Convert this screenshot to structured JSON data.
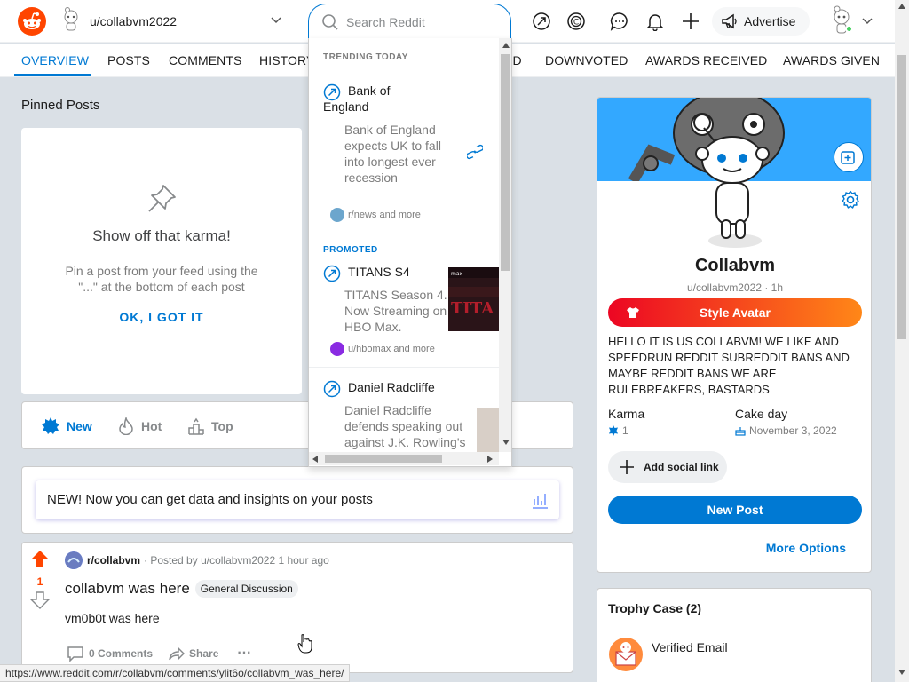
{
  "header": {
    "username": "u/collabvm2022",
    "search_placeholder": "Search Reddit",
    "advertise_label": "Advertise"
  },
  "tabs": [
    {
      "label": "OVERVIEW",
      "active": true
    },
    {
      "label": "POSTS"
    },
    {
      "label": "COMMENTS"
    },
    {
      "label": "HISTORY"
    },
    {
      "label": "ED"
    },
    {
      "label": "DOWNVOTED"
    },
    {
      "label": "AWARDS RECEIVED"
    },
    {
      "label": "AWARDS GIVEN"
    }
  ],
  "trending": {
    "heading": "TRENDING TODAY",
    "promo_heading": "PROMOTED",
    "items": [
      {
        "title": "Bank of England",
        "desc": "Bank of England expects UK to fall into longest ever recession",
        "source": "r/news and more"
      },
      {
        "title": "TITANS S4",
        "desc": "TITANS Season 4. Now Streaming on HBO Max.",
        "source": "u/hbomax and more",
        "thumb_text": "TITA"
      },
      {
        "title": "Daniel Radcliffe",
        "desc": "Daniel Radcliffe defends speaking out against J.K. Rowling's"
      }
    ]
  },
  "pinned": {
    "title": "Pinned Posts",
    "card_title": "Show off that karma!",
    "card_desc": "Pin a post from your feed using the \"...\" at the bottom of each post",
    "card_button": "OK, I GOT IT"
  },
  "sort": {
    "new": "New",
    "hot": "Hot",
    "top": "Top"
  },
  "insights_text": "NEW! Now you can get data and insights on your posts",
  "post": {
    "subreddit": "r/collabvm",
    "meta": "· Posted by u/collabvm2022 1 hour ago",
    "score": "1",
    "title": "collabvm was here",
    "flair": "General Discussion",
    "body": "vm0b0t was here",
    "comments": "0 Comments",
    "share": "Share",
    "more": "···"
  },
  "status_url": "https://www.reddit.com/r/collabvm/comments/ylit6o/collabvm_was_here/",
  "profile": {
    "name": "Collabvm",
    "sub": "u/collabvm2022 · 1h",
    "style_avatar": "Style Avatar",
    "about": "HELLO IT IS US COLLABVM! WE LIKE AND SPEEDRUN REDDIT SUBREDDIT BANS AND MAYBE REDDIT BANS WE ARE RULEBREAKERS, BASTARDS",
    "karma_label": "Karma",
    "karma_value": "1",
    "cakeday_label": "Cake day",
    "cakeday_value": "November 3, 2022",
    "social": "Add social link",
    "new_post": "New Post",
    "more_options": "More Options"
  },
  "trophy": {
    "title": "Trophy Case (2)",
    "item": "Verified Email"
  },
  "colors": {
    "brand": "#ff4500",
    "accent": "#0079d3"
  }
}
